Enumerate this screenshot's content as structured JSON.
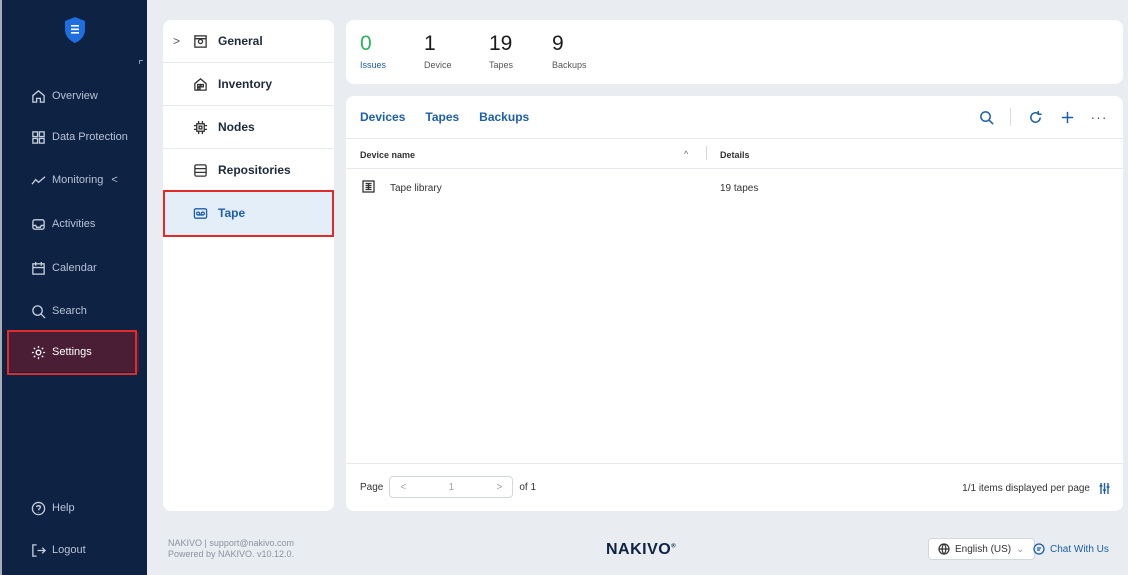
{
  "sidebar": {
    "items": [
      {
        "label": "Overview",
        "icon": "home-icon"
      },
      {
        "label": "Data Protection",
        "icon": "grid-icon"
      },
      {
        "label": "Monitoring",
        "icon": "chart-icon"
      },
      {
        "label": "Activities",
        "icon": "inbox-icon"
      },
      {
        "label": "Calendar",
        "icon": "calendar-icon"
      },
      {
        "label": "Search",
        "icon": "search-icon"
      },
      {
        "label": "Settings",
        "icon": "gear-icon"
      }
    ],
    "monitoring_chevron": "<",
    "help": "Help",
    "logout": "Logout"
  },
  "settings_menu": {
    "expand_chevron": ">",
    "items": [
      {
        "label": "General"
      },
      {
        "label": "Inventory"
      },
      {
        "label": "Nodes"
      },
      {
        "label": "Repositories"
      },
      {
        "label": "Tape"
      }
    ]
  },
  "stats": {
    "issues": {
      "value": "0",
      "label": "Issues"
    },
    "device": {
      "value": "1",
      "label": "Device"
    },
    "tapes": {
      "value": "19",
      "label": "Tapes"
    },
    "backups": {
      "value": "9",
      "label": "Backups"
    }
  },
  "main": {
    "tabs": [
      "Devices",
      "Tapes",
      "Backups"
    ],
    "more": "···",
    "columns": {
      "device_name": "Device name",
      "details": "Details",
      "sort": "^"
    },
    "rows": [
      {
        "device_name": "Tape library",
        "details": "19 tapes"
      }
    ],
    "pager": {
      "page_label": "Page",
      "prev": "<",
      "page": "1",
      "next": ">",
      "of": "of 1"
    },
    "per_page": "1/1 items displayed per page"
  },
  "footer": {
    "info_line1": "NAKIVO | support@nakivo.com",
    "info_line2": "Powered by NAKIVO. v10.12.0.",
    "brand": "NAKIVO",
    "brand_mark": "®",
    "language": "English (US)",
    "language_chevron": "⌄",
    "chat": "Chat With Us"
  },
  "colors": {
    "sidebar_bg": "#0e2244",
    "accent": "#1d5fa8",
    "issues_green": "#2bb35a",
    "highlight_red": "#e02b2b",
    "active_sidebar": "#4a1f35"
  }
}
